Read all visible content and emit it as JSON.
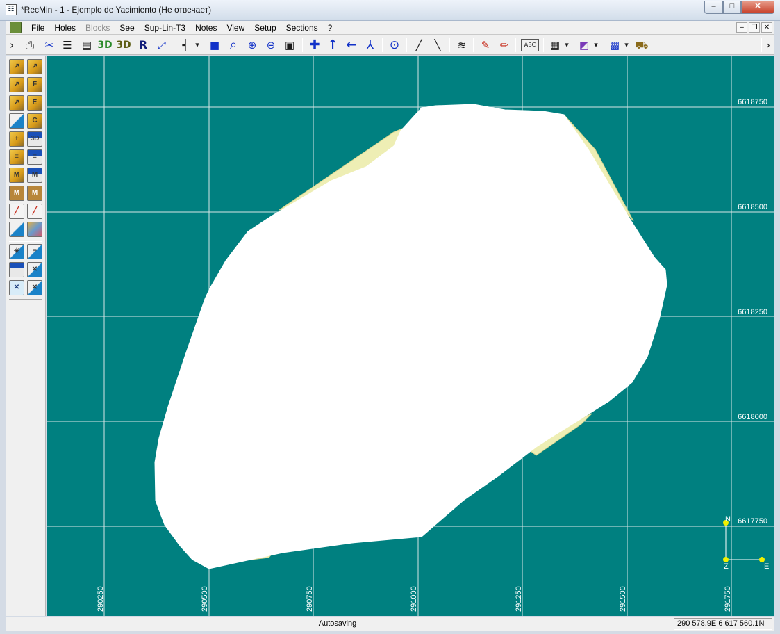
{
  "window": {
    "title": "*RecMin - 1 - Ejemplo de Yacimiento (Не отвечает)",
    "app_icon_glyph": "☷",
    "minimize_glyph": "–",
    "maximize_glyph": "□",
    "close_glyph": "✕"
  },
  "menu": {
    "items": [
      {
        "label": "File",
        "enabled": true
      },
      {
        "label": "Holes",
        "enabled": true
      },
      {
        "label": "Blocks",
        "enabled": false
      },
      {
        "label": "See",
        "enabled": true
      },
      {
        "label": "Sup-Lin-T3",
        "enabled": true
      },
      {
        "label": "Notes",
        "enabled": true
      },
      {
        "label": "View",
        "enabled": true
      },
      {
        "label": "Setup",
        "enabled": true
      },
      {
        "label": "Sections",
        "enabled": true
      },
      {
        "label": "?",
        "enabled": true
      }
    ],
    "mdi_minimize_glyph": "–",
    "mdi_restore_glyph": "❐",
    "mdi_close_glyph": "✕"
  },
  "toolbar": {
    "chevron_left": "›",
    "chevron_right": "›",
    "print_icon": "⎙",
    "scissors_icon": "✂",
    "tree_icon": "☰",
    "table_icon": "▤",
    "btn_3d_label": "3D",
    "btn_3d_shaded_label": "3D",
    "btn_r_label": "R",
    "expand_icon": "⤢",
    "grid_cross_icon": "┥",
    "dropdown_arrow": "▾",
    "fill_rect_icon": "■",
    "zoom_icon": "⌕",
    "zoom_in_icon": "⊕",
    "zoom_out_icon": "⊖",
    "frame_icon": "▣",
    "cross_icon": "✚",
    "arrow_up_icon": "↑",
    "arrow_left_icon": "←",
    "axes_icon": "⅄",
    "target_icon": "⊙",
    "measure_icon": "╱",
    "measure2_icon": "╲",
    "contour_icon": "≋",
    "pencil_icon": "✎",
    "pencil2_icon": "✏",
    "label_icon": "ABC",
    "gridtable_icon": "▦",
    "color_icon": "◩",
    "window_icon": "▩",
    "truck_icon": "⛟"
  },
  "left_toolbar": {
    "buttons": [
      {
        "glyph": "↗",
        "style": "folder"
      },
      {
        "glyph": "↗",
        "style": "folder"
      },
      {
        "glyph": "↗",
        "style": "folder"
      },
      {
        "glyph": "F",
        "style": "folder"
      },
      {
        "glyph": "↗",
        "style": "folder"
      },
      {
        "glyph": "E",
        "style": "folder"
      },
      {
        "glyph": "",
        "style": "tri"
      },
      {
        "glyph": "C",
        "style": "folder"
      },
      {
        "glyph": "+",
        "style": "folder"
      },
      {
        "glyph": "3D",
        "style": "disk"
      },
      {
        "glyph": "≡",
        "style": "folder"
      },
      {
        "glyph": "≡",
        "style": "disk"
      },
      {
        "glyph": "M",
        "style": "folder"
      },
      {
        "glyph": "M",
        "style": "disk"
      },
      {
        "glyph": "M",
        "style": "book"
      },
      {
        "glyph": "M",
        "style": "book"
      },
      {
        "glyph": "╱",
        "style": "line"
      },
      {
        "glyph": "╱",
        "style": "line"
      },
      {
        "glyph": "",
        "style": "tri"
      },
      {
        "glyph": "",
        "style": "map"
      },
      {
        "glyph": "☀",
        "style": "tri"
      },
      {
        "glyph": "≡",
        "style": "tri"
      },
      {
        "glyph": "",
        "style": "disk"
      },
      {
        "glyph": "✕",
        "style": "tri"
      },
      {
        "glyph": "✕",
        "style": "box"
      },
      {
        "glyph": "✕",
        "style": "tri"
      }
    ]
  },
  "map": {
    "background": "#008080",
    "grid_color": "#d8e6e6",
    "body_fill": "#ffffff",
    "body_edge_fill": "#eeeeb4",
    "body_edge_stroke": "#d6d690",
    "x_labels": [
      "290250",
      "290500",
      "290750",
      "291000",
      "291250",
      "291500",
      "291750"
    ],
    "y_labels": [
      "6618750",
      "6618500",
      "6618250",
      "6618000",
      "6617750"
    ],
    "compass": {
      "north": "N",
      "east": "E",
      "origin": "Z",
      "node_color": "#f0f000"
    }
  },
  "status": {
    "message": "Autosaving",
    "coordinates": "290 578.9E 6 617 560.1N"
  }
}
